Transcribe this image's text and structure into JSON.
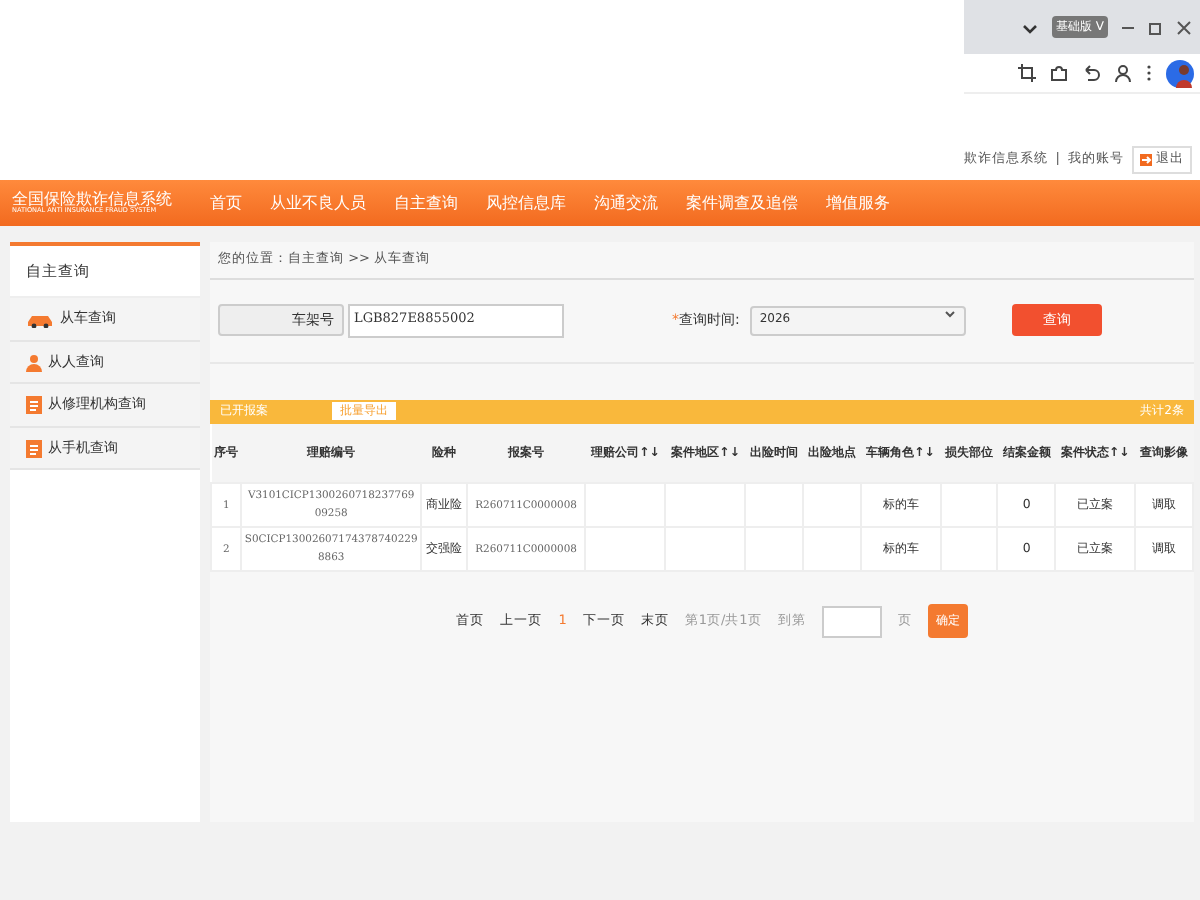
{
  "browser": {
    "badge": "基础版",
    "badge_letter": "V"
  },
  "top_links": {
    "system": "欺诈信息系统",
    "separator": "|",
    "account": "我的账号",
    "logout": "退出"
  },
  "logo": {
    "title": "全国保险欺诈信息系统",
    "subtitle": "NATIONAL ANTI INSURANCE FRAUD SYSTEM"
  },
  "nav": [
    {
      "label": "首页"
    },
    {
      "label": "从业不良人员"
    },
    {
      "label": "自主查询"
    },
    {
      "label": "风控信息库"
    },
    {
      "label": "沟通交流"
    },
    {
      "label": "案件调查及追偿"
    },
    {
      "label": "增值服务"
    }
  ],
  "sidebar": {
    "title": "自主查询",
    "items": [
      {
        "label": "从车查询",
        "kind": "car"
      },
      {
        "label": "从人查询",
        "kind": "person"
      },
      {
        "label": "从修理机构查询",
        "kind": "doc"
      },
      {
        "label": "从手机查询",
        "kind": "doc"
      }
    ]
  },
  "breadcrumb": "您的位置：自主查询 >> 从车查询",
  "form": {
    "type_select": "车架号",
    "vin": "LGB827E8855002",
    "time_required": "*",
    "time_label": "查询时间:",
    "time_select": "2026",
    "search_button": "查询"
  },
  "result_bar": {
    "title": "已开报案",
    "export_button": "批量导出",
    "total": "共计2条"
  },
  "table": {
    "columns": [
      "序号",
      "理赔编号",
      "险种",
      "报案号",
      "理赔公司↑↓",
      "案件地区↑↓",
      "出险时间",
      "出险地点",
      "车辆角色↑↓",
      "损失部位",
      "结案金额",
      "案件状态↑↓",
      "查询影像"
    ],
    "rows": [
      [
        "1",
        "V3101CICP1300260718237769 09258",
        "商业险",
        "R260711C0000008",
        "",
        "",
        "",
        "",
        "标的车",
        "",
        "0",
        "已立案",
        "调取"
      ],
      [
        "2",
        "S0CICP13002607174378740229 8863",
        "交强险",
        "R260711C0000008",
        "",
        "",
        "",
        "",
        "标的车",
        "",
        "0",
        "已立案",
        "调取"
      ]
    ]
  },
  "pager": {
    "first": "首页",
    "prev": "上一页",
    "current": "1",
    "next": "下一页",
    "last": "末页",
    "info": "第1页/共1页",
    "goto": "到第",
    "unit": "页",
    "confirm": "确定"
  }
}
